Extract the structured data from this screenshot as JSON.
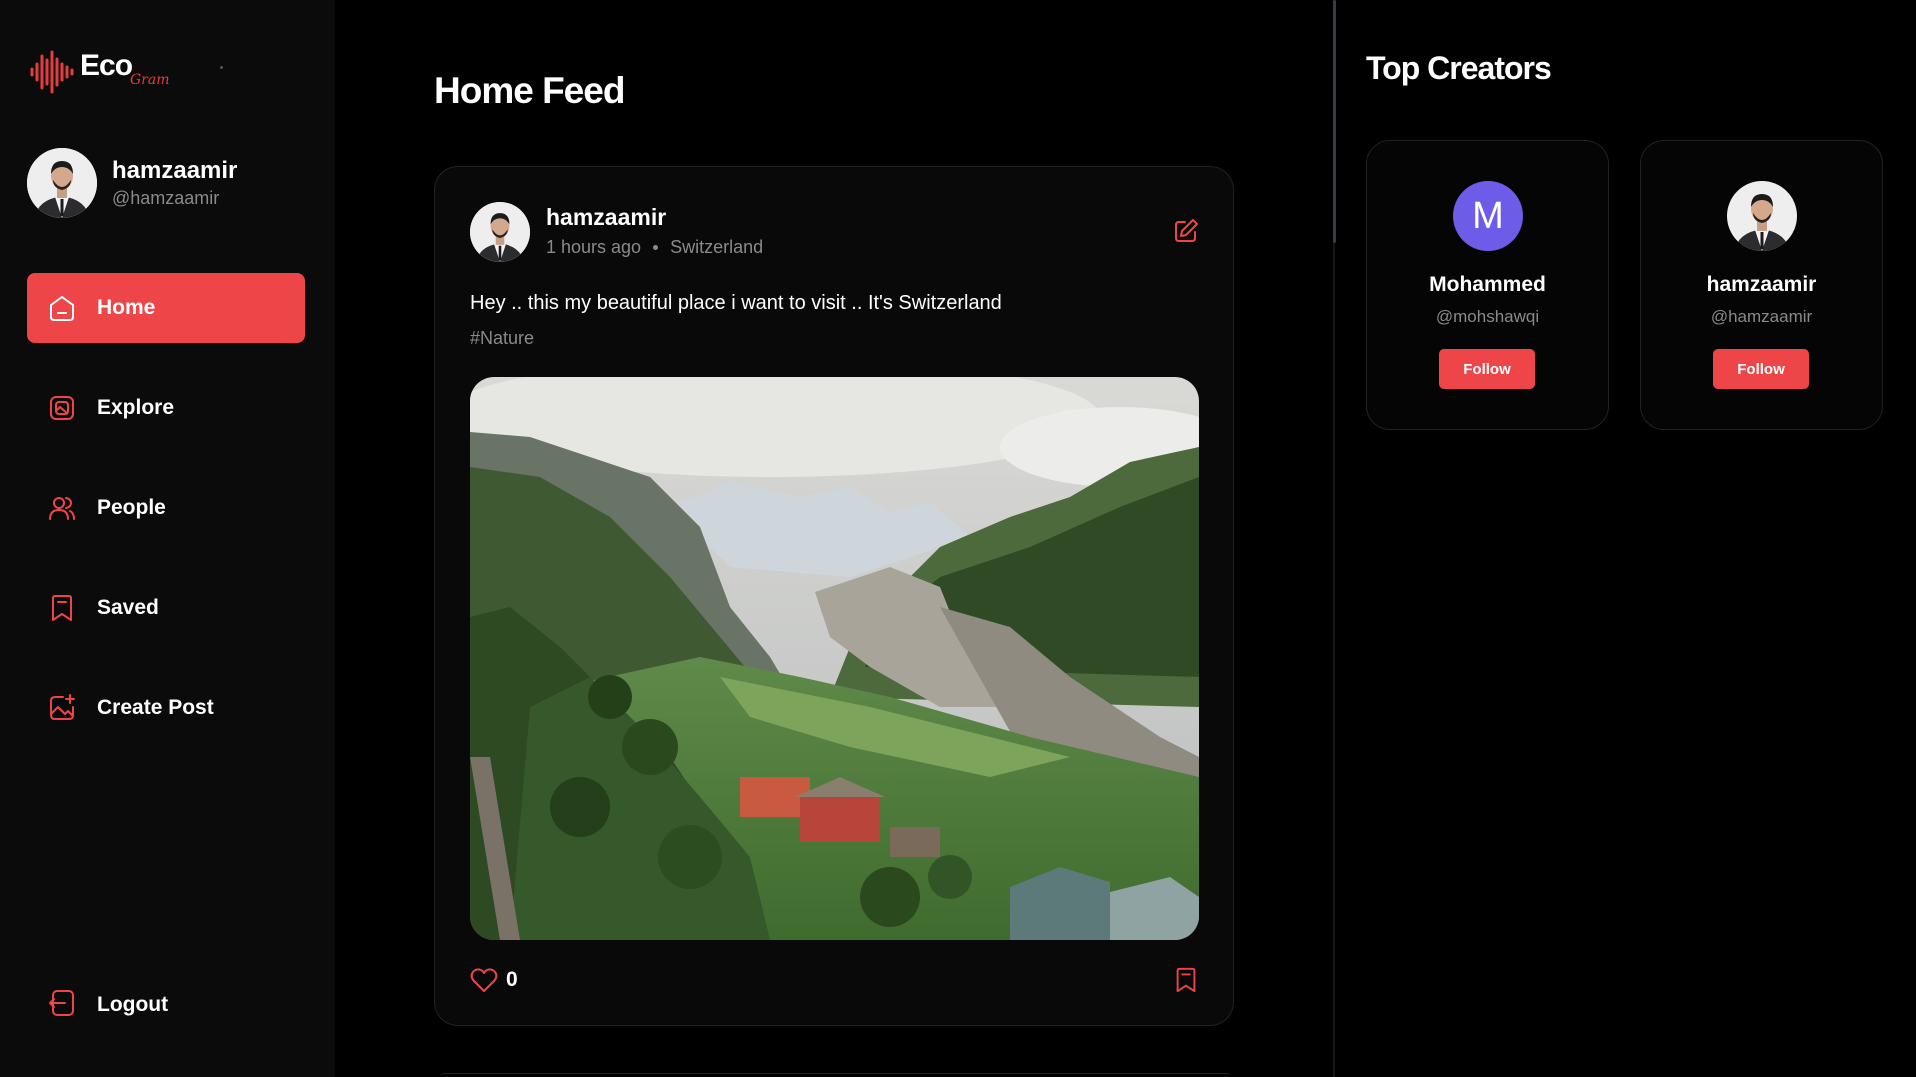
{
  "brand": {
    "logo_text": "Eco",
    "logo_subtext": "Gram",
    "accent_color": "#ee4648"
  },
  "current_user": {
    "name": "hamzaamir",
    "handle": "@hamzaamir"
  },
  "sidebar": {
    "items": [
      {
        "label": "Home",
        "icon": "home-icon",
        "active": true
      },
      {
        "label": "Explore",
        "icon": "explore-icon",
        "active": false
      },
      {
        "label": "People",
        "icon": "people-icon",
        "active": false
      },
      {
        "label": "Saved",
        "icon": "saved-icon",
        "active": false
      },
      {
        "label": "Create Post",
        "icon": "create-post-icon",
        "active": false
      }
    ],
    "logout_label": "Logout"
  },
  "feed": {
    "title": "Home Feed",
    "post": {
      "author": "hamzaamir",
      "time": "1 hours ago",
      "location": "Switzerland",
      "caption": "Hey .. this my beautiful place i want to visit .. It's Switzerland",
      "tag": "#Nature",
      "image_subject": "mountain-valley-photo",
      "likes": "0"
    }
  },
  "top_creators": {
    "title": "Top Creators",
    "creators": [
      {
        "name": "Mohammed",
        "handle": "@mohshawqi",
        "avatar_letter": "M",
        "avatar_color": "#6c5ce7",
        "button": "Follow"
      },
      {
        "name": "hamzaamir",
        "handle": "@hamzaamir",
        "button": "Follow"
      }
    ]
  }
}
